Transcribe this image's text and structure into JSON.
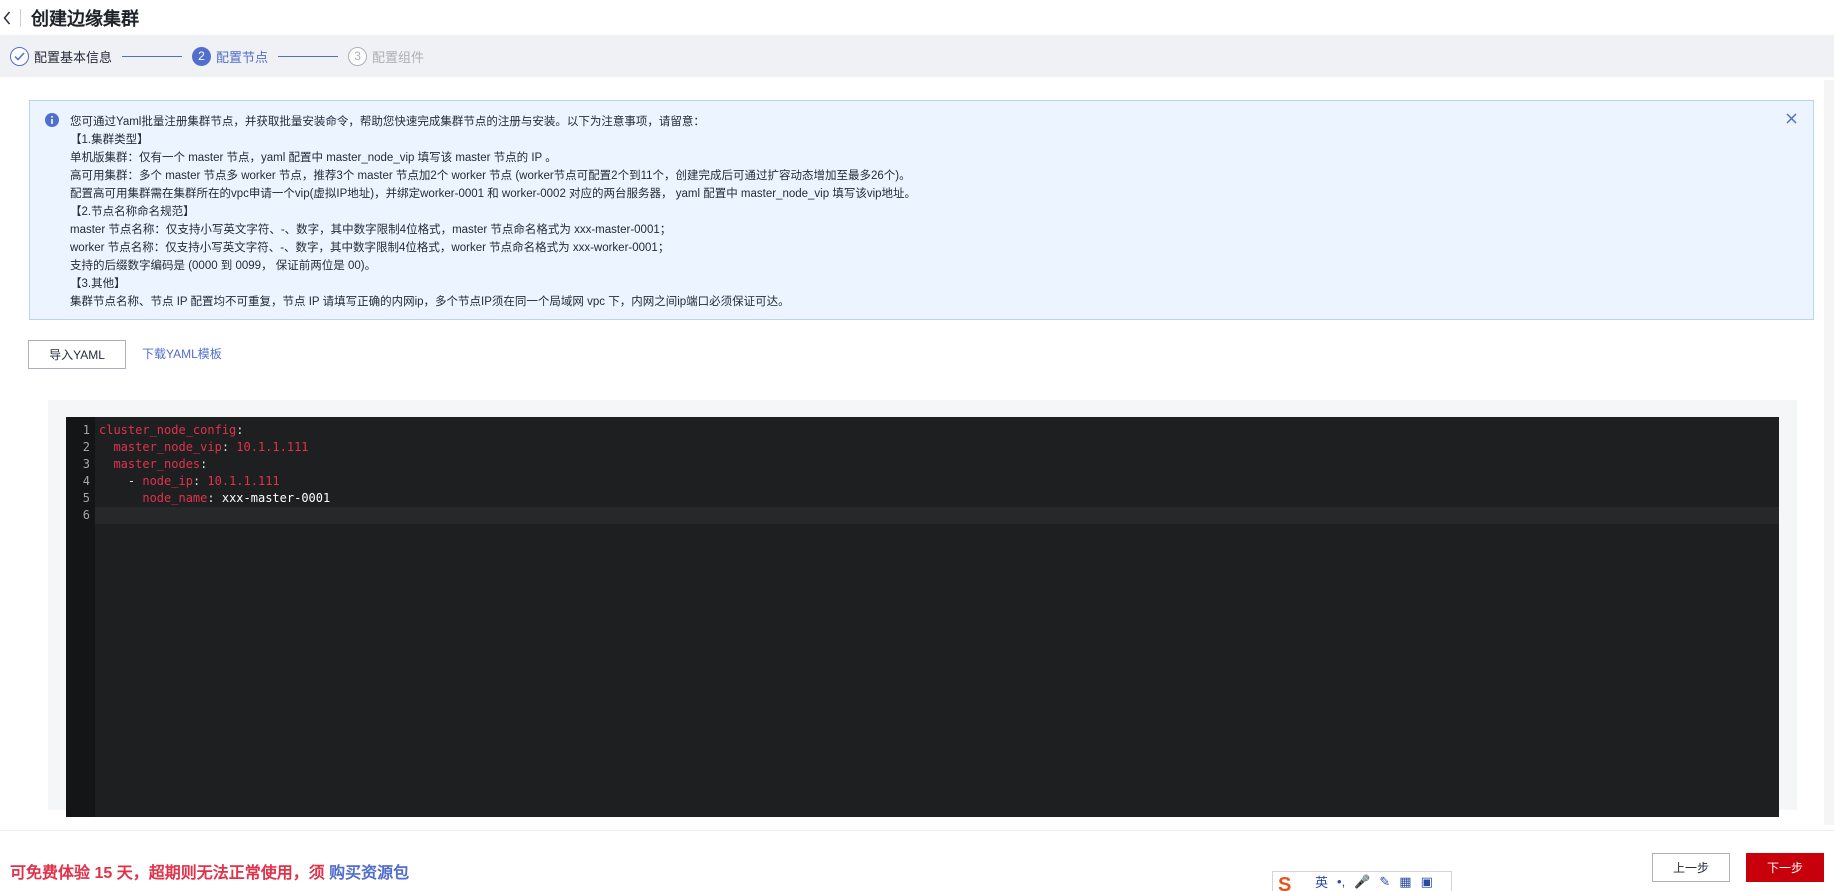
{
  "header": {
    "title": "创建边缘集群"
  },
  "steps": [
    {
      "number": "",
      "label": "配置基本信息",
      "state": "done"
    },
    {
      "number": "2",
      "label": "配置节点",
      "state": "active"
    },
    {
      "number": "3",
      "label": "配置组件",
      "state": "todo"
    }
  ],
  "notice": {
    "lines": [
      "您可通过Yaml批量注册集群节点，并获取批量安装命令，帮助您快速完成集群节点的注册与安装。以下为注意事项，请留意：",
      "【1.集群类型】",
      "单机版集群：仅有一个 master 节点，yaml 配置中 master_node_vip 填写该 master 节点的 IP 。",
      "高可用集群：多个 master 节点多 worker 节点，推荐3个 master 节点加2个 worker 节点 (worker节点可配置2个到11个，创建完成后可通过扩容动态增加至最多26个)。",
      "配置高可用集群需在集群所在的vpc申请一个vip(虚拟IP地址)，并绑定worker-0001 和 worker-0002 对应的两台服务器， yaml 配置中 master_node_vip 填写该vip地址。",
      "【2.节点名称命名规范】",
      "master 节点名称：仅支持小写英文字符、-、数字，其中数字限制4位格式，master 节点命名格式为 xxx-master-0001；",
      "worker 节点名称：仅支持小写英文字符、-、数字，其中数字限制4位格式，worker 节点命名格式为 xxx-worker-0001；",
      "支持的后缀数字编码是 (0000 到 0099， 保证前两位是 00)。",
      "【3.其他】",
      "集群节点名称、节点 IP 配置均不可重复，节点 IP 请填写正确的内网ip，多个节点IP须在同一个局域网 vpc 下，内网之间ip端口必须保证可达。"
    ]
  },
  "actions": {
    "import_label": "导入YAML",
    "download_label": "下载YAML模板"
  },
  "editor": {
    "line_numbers": [
      "1",
      "2",
      "3",
      "4",
      "5",
      "6"
    ],
    "lines": [
      {
        "indent": "",
        "key": "cluster_node_config",
        "sep": ":",
        "value": "",
        "value_kind": ""
      },
      {
        "indent": "  ",
        "key": "master_node_vip",
        "sep": ": ",
        "value": "10.1.1.111",
        "value_kind": "num"
      },
      {
        "indent": "  ",
        "key": "master_nodes",
        "sep": ":",
        "value": "",
        "value_kind": ""
      },
      {
        "indent": "    - ",
        "key": "node_ip",
        "sep": ": ",
        "value": "10.1.1.111",
        "value_kind": "num"
      },
      {
        "indent": "      ",
        "key": "node_name",
        "sep": ": ",
        "value": "xxx-master-0001",
        "value_kind": "str"
      },
      {
        "indent": "",
        "key": "",
        "sep": "",
        "value": "",
        "value_kind": ""
      }
    ]
  },
  "footer": {
    "trial_text": "可免费体验 15 天，超期则无法正常使用，须 ",
    "buy_link": "购买资源包",
    "prev_label": "上一步",
    "next_label": "下一步",
    "ime_labels": [
      "英",
      "•,",
      "🎤",
      "✎",
      "▦",
      "▣"
    ]
  },
  "colors": {
    "accent": "#526ecc",
    "danger": "#c7000b",
    "notice_bg": "#ebf4ff",
    "editor_bg": "#1e1f20"
  }
}
